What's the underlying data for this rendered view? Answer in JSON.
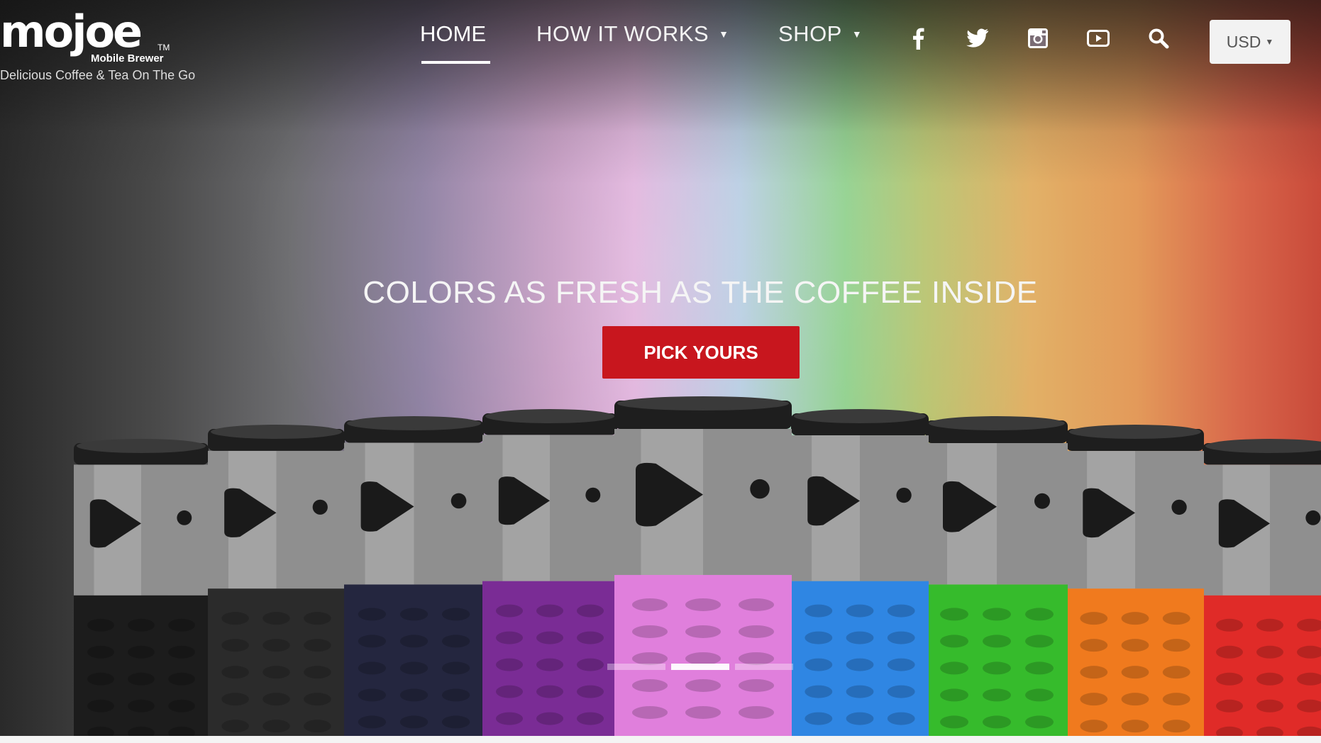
{
  "brand": {
    "logo_word": "mojoe",
    "tm": "TM",
    "sub": "Mobile Brewer",
    "tagline": "Delicious Coffee & Tea On The Go"
  },
  "nav": {
    "home": "HOME",
    "how_it_works": "HOW IT WORKS",
    "shop": "SHOP"
  },
  "social_icons": [
    "facebook-icon",
    "twitter-icon",
    "instagram-icon",
    "youtube-icon",
    "search-icon"
  ],
  "currency": "USD",
  "hero": {
    "headline": "COLORS AS FRESH AS THE COFFEE INSIDE",
    "cta": "PICK YOURS",
    "slide_count": 3,
    "active_slide": 2
  },
  "brewers": [
    {
      "color": "#1c1c1c"
    },
    {
      "color": "#2b2b2b"
    },
    {
      "color": "#24263f"
    },
    {
      "color": "#7a2c95"
    },
    {
      "color": "#e07fdc"
    },
    {
      "color": "#2f86e3"
    },
    {
      "color": "#36bb2c"
    },
    {
      "color": "#f07a1e"
    },
    {
      "color": "#e02b28"
    }
  ]
}
